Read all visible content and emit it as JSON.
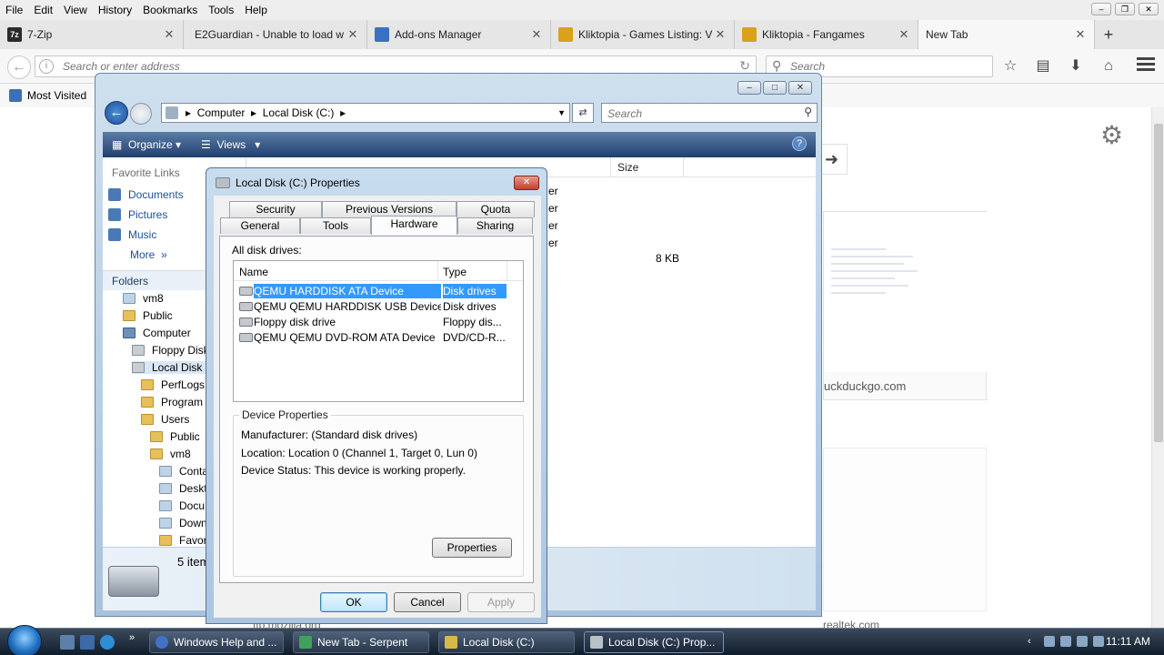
{
  "browser": {
    "menu": [
      "File",
      "Edit",
      "View",
      "History",
      "Bookmarks",
      "Tools",
      "Help"
    ],
    "tabs": [
      {
        "label": "7-Zip",
        "icon": "7zip-icon",
        "color": "#2b2b2b"
      },
      {
        "label": "E2Guardian - Unable to load w",
        "icon": "page-icon",
        "color": "#cccccc"
      },
      {
        "label": "Add-ons Manager",
        "icon": "puzzle-icon",
        "color": "#3b6fc4"
      },
      {
        "label": "Kliktopia - Games Listing: V",
        "icon": "kliktopia-icon",
        "color": "#d9a21b"
      },
      {
        "label": "Kliktopia - Fangames",
        "icon": "kliktopia-icon",
        "color": "#d9a21b"
      }
    ],
    "active_tab": "New Tab",
    "url_placeholder": "Search or enter address",
    "search_placeholder": "Search",
    "bookmarks_label": "Most Visited",
    "newtab": {
      "thumb_caption": "uckduckgo.com",
      "footer_left": "ftp.mozilla.org",
      "footer_right": "realtek.com"
    }
  },
  "explorer": {
    "breadcrumb": [
      "Computer",
      "Local Disk (C:)"
    ],
    "search_placeholder": "Search",
    "commands": {
      "organize": "Organize",
      "views": "Views"
    },
    "favorite_links_header": "Favorite Links",
    "favorite_links": [
      "Documents",
      "Pictures",
      "Music"
    ],
    "more_label": "More",
    "folders_header": "Folders",
    "tree": [
      {
        "label": "vm8",
        "icon": "user-folder"
      },
      {
        "label": "Public",
        "icon": "folder"
      },
      {
        "label": "Computer",
        "icon": "computer"
      },
      {
        "label": "Floppy Disk",
        "icon": "disk"
      },
      {
        "label": "Local Disk (C",
        "icon": "disk"
      },
      {
        "label": "PerfLogs",
        "icon": "folder"
      },
      {
        "label": "Program F",
        "icon": "folder"
      },
      {
        "label": "Users",
        "icon": "folder"
      },
      {
        "label": "Public",
        "icon": "folder"
      },
      {
        "label": "vm8",
        "icon": "folder"
      },
      {
        "label": "Conta",
        "icon": "doc"
      },
      {
        "label": "Deskto",
        "icon": "doc"
      },
      {
        "label": "Docu",
        "icon": "doc"
      },
      {
        "label": "Downl",
        "icon": "doc"
      },
      {
        "label": "Favori",
        "icon": "folder"
      }
    ],
    "col_size": "Size",
    "row_type_fragments": [
      "er",
      "er",
      "er",
      "er"
    ],
    "file_size": "8 KB",
    "items_count": "5 item"
  },
  "dialog": {
    "title": "Local Disk (C:) Properties",
    "tabs_top": [
      "Security",
      "Previous Versions",
      "Quota"
    ],
    "tabs_bottom": [
      "General",
      "Tools",
      "Hardware",
      "Sharing"
    ],
    "active_tab": "Hardware",
    "all_drives_label": "All disk drives:",
    "columns": {
      "name": "Name",
      "type": "Type"
    },
    "drives": [
      {
        "name": "QEMU HARDDISK ATA Device",
        "type": "Disk drives"
      },
      {
        "name": "QEMU QEMU HARDDISK USB Device",
        "type": "Disk drives"
      },
      {
        "name": "Floppy disk drive",
        "type": "Floppy dis..."
      },
      {
        "name": "QEMU QEMU DVD-ROM ATA Device",
        "type": "DVD/CD-R..."
      }
    ],
    "device_properties": {
      "legend": "Device Properties",
      "manufacturer": "Manufacturer: (Standard disk drives)",
      "location": "Location: Location 0 (Channel 1, Target 0, Lun 0)",
      "status": "Device Status: This device is working properly."
    },
    "buttons": {
      "properties": "Properties",
      "ok": "OK",
      "cancel": "Cancel",
      "apply": "Apply"
    }
  },
  "taskbar": {
    "buttons": [
      "Windows Help and ...",
      "New Tab - Serpent",
      "Local Disk (C:)",
      "Local Disk (C:) Prop..."
    ],
    "clock": "11:11 AM"
  }
}
